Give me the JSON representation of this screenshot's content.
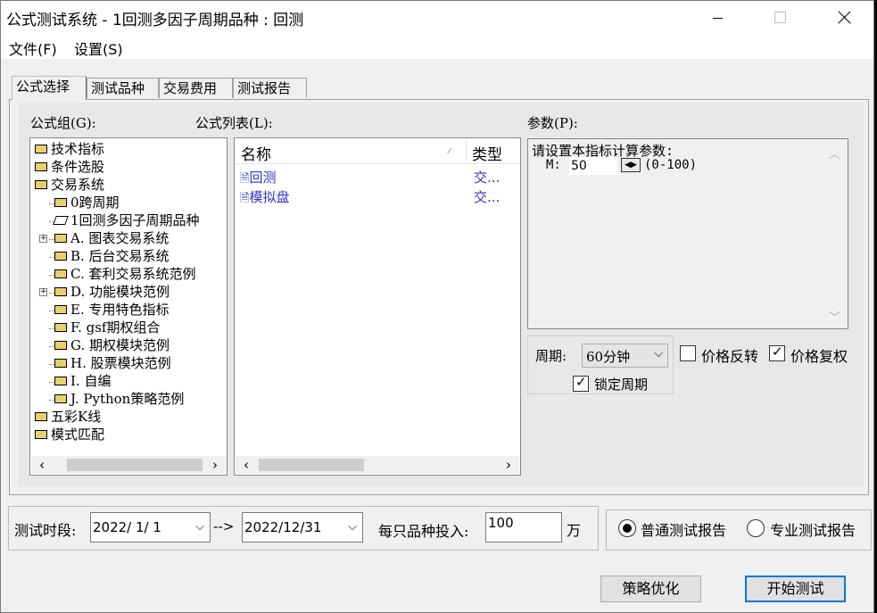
{
  "window": {
    "title": "公式测试系统 - 1回测多因子周期品种 : 回测"
  },
  "menu": [
    "文件(F)",
    "设置(S)"
  ],
  "tabs": [
    "公式选择",
    "测试品种",
    "交易费用",
    "测试报告"
  ],
  "labels": {
    "group": "公式组(G):",
    "list": "公式列表(L):",
    "params": "参数(P):"
  },
  "tree": [
    {
      "label": "技术指标",
      "level": 0
    },
    {
      "label": "条件选股",
      "level": 0
    },
    {
      "label": "交易系统",
      "level": 0
    },
    {
      "label": "0跨周期",
      "level": 1
    },
    {
      "label": "1回测多因子周期品种",
      "level": 1,
      "selected": true
    },
    {
      "label": "A. 图表交易系统",
      "level": 1,
      "expandable": true
    },
    {
      "label": "B. 后台交易系统",
      "level": 1
    },
    {
      "label": "C. 套利交易系统范例",
      "level": 1
    },
    {
      "label": "D. 功能模块范例",
      "level": 1,
      "expandable": true
    },
    {
      "label": "E. 专用特色指标",
      "level": 1
    },
    {
      "label": "F. gsf期权组合",
      "level": 1
    },
    {
      "label": "G. 期权模块范例",
      "level": 1
    },
    {
      "label": "H. 股票模块范例",
      "level": 1
    },
    {
      "label": "I. 自编",
      "level": 1
    },
    {
      "label": "J. Python策略范例",
      "level": 1
    },
    {
      "label": "五彩K线",
      "level": 0
    },
    {
      "label": "模式匹配",
      "level": 0
    }
  ],
  "list": {
    "columns": [
      "名称",
      "类型"
    ],
    "rows": [
      {
        "name": "回测",
        "type": "交..."
      },
      {
        "name": "模拟盘",
        "type": "交..."
      }
    ]
  },
  "params": {
    "prompt": "请设置本指标计算参数:",
    "name": "M:",
    "value": "50",
    "range": "(0-100)"
  },
  "period": {
    "label": "周期:",
    "value": "60分钟",
    "lock_label": "锁定周期",
    "lock_checked": true
  },
  "options": {
    "price_reverse": {
      "label": "价格反转",
      "checked": false
    },
    "price_adjust": {
      "label": "价格复权",
      "checked": true
    }
  },
  "bottom": {
    "period_label": "测试时段:",
    "start": "2022/ 1/ 1",
    "arrow": "-->",
    "end": "2022/12/31",
    "invest_label": "每只品种投入:",
    "invest_value": "100",
    "unit": "万",
    "report_normal": "普通测试报告",
    "report_pro": "专业测试报告",
    "report_selected": "normal"
  },
  "buttons": {
    "optimize": "策略优化",
    "start": "开始测试"
  }
}
